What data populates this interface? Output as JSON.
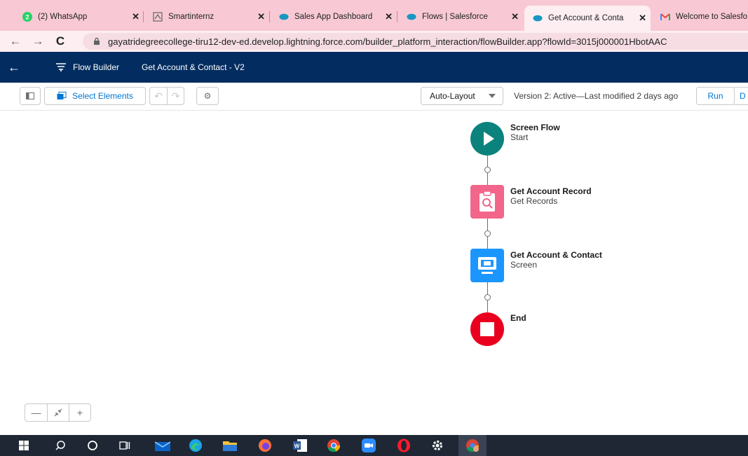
{
  "browser": {
    "tabs": [
      {
        "title": "(2) WhatsApp",
        "icon": "whatsapp-icon"
      },
      {
        "title": "Smartinternz",
        "icon": "smartinternz-icon"
      },
      {
        "title": "Sales App Dashboard",
        "icon": "salesforce-cloud-icon"
      },
      {
        "title": "Flows | Salesforce",
        "icon": "salesforce-cloud-icon"
      },
      {
        "title": "Get Account & Conta",
        "icon": "salesforce-cloud-icon",
        "active": true
      },
      {
        "title": "Welcome to Salesfo",
        "icon": "gmail-icon"
      }
    ],
    "whatsapp_badge": "2",
    "url": "gayatridegreecollege-tiru12-dev-ed.develop.lightning.force.com/builder_platform_interaction/flowBuilder.app?flowId=3015j000001HbotAAC"
  },
  "header": {
    "app_name": "Flow Builder",
    "flow_title": "Get Account & Contact - V2"
  },
  "toolbar": {
    "select_elements": "Select Elements",
    "layout_mode": "Auto-Layout",
    "version_status": "Version 2: Active—Last modified 2 days ago",
    "run": "Run",
    "debug": "D"
  },
  "flow": {
    "nodes": [
      {
        "title": "Screen Flow",
        "subtitle": "Start",
        "icon": "play-icon",
        "color": "#0b827c"
      },
      {
        "title": "Get Account Record",
        "subtitle": "Get Records",
        "icon": "get-records-icon",
        "color": "#f2668b"
      },
      {
        "title": "Get Account & Contact",
        "subtitle": "Screen",
        "icon": "screen-icon",
        "color": "#1b96ff"
      },
      {
        "title": "End",
        "subtitle": "",
        "icon": "stop-icon",
        "color": "#ea001e"
      }
    ]
  },
  "zoom": {
    "out": "—",
    "fit": "fit-view",
    "in": "+"
  },
  "taskbar": {
    "apps": [
      "windows-start-icon",
      "search-icon",
      "cortana-icon",
      "task-view-icon",
      "mail-icon",
      "edge-icon",
      "file-explorer-icon",
      "firefox-icon",
      "word-icon",
      "chrome-icon",
      "zoom-icon",
      "opera-icon",
      "settings-icon",
      "chrome-profile-icon"
    ]
  }
}
